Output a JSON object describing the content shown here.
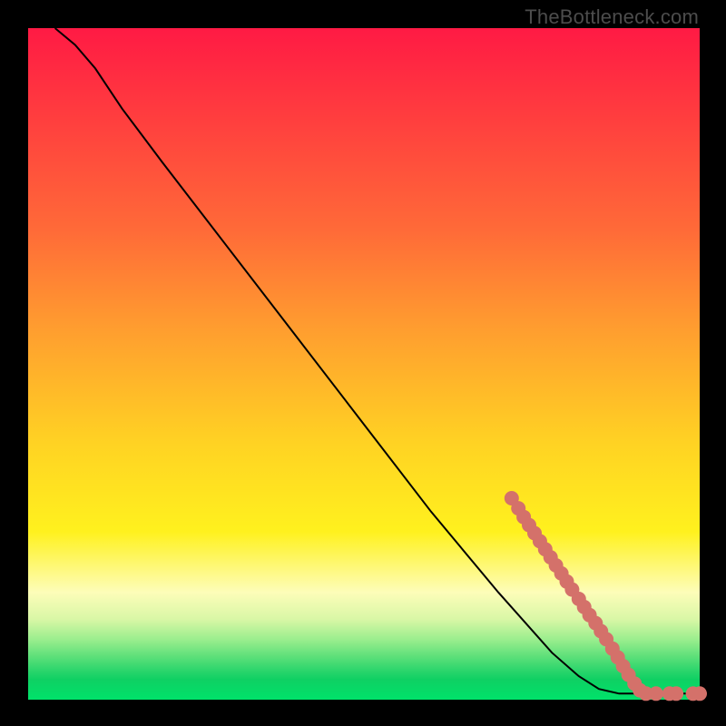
{
  "attribution": "TheBottleneck.com",
  "chart_data": {
    "type": "line",
    "title": "",
    "xlabel": "",
    "ylabel": "",
    "xlim": [
      0,
      100
    ],
    "ylim": [
      0,
      100
    ],
    "curve": [
      {
        "x": 4,
        "y": 100
      },
      {
        "x": 7,
        "y": 97.5
      },
      {
        "x": 10,
        "y": 94
      },
      {
        "x": 14,
        "y": 88
      },
      {
        "x": 20,
        "y": 80
      },
      {
        "x": 30,
        "y": 67
      },
      {
        "x": 40,
        "y": 54
      },
      {
        "x": 50,
        "y": 41
      },
      {
        "x": 60,
        "y": 28
      },
      {
        "x": 70,
        "y": 16
      },
      {
        "x": 78,
        "y": 7
      },
      {
        "x": 82,
        "y": 3.5
      },
      {
        "x": 85,
        "y": 1.6
      },
      {
        "x": 88,
        "y": 0.9
      },
      {
        "x": 92,
        "y": 0.9
      },
      {
        "x": 96,
        "y": 0.9
      },
      {
        "x": 100,
        "y": 0.9
      }
    ],
    "markers": [
      {
        "x": 72.0,
        "y": 30.0
      },
      {
        "x": 73.0,
        "y": 28.5
      },
      {
        "x": 73.8,
        "y": 27.2
      },
      {
        "x": 74.6,
        "y": 26.0
      },
      {
        "x": 75.4,
        "y": 24.8
      },
      {
        "x": 76.2,
        "y": 23.6
      },
      {
        "x": 77.0,
        "y": 22.4
      },
      {
        "x": 77.8,
        "y": 21.2
      },
      {
        "x": 78.6,
        "y": 20.0
      },
      {
        "x": 79.4,
        "y": 18.8
      },
      {
        "x": 80.2,
        "y": 17.6
      },
      {
        "x": 81.0,
        "y": 16.4
      },
      {
        "x": 82.0,
        "y": 15.0
      },
      {
        "x": 82.8,
        "y": 13.8
      },
      {
        "x": 83.6,
        "y": 12.6
      },
      {
        "x": 84.5,
        "y": 11.4
      },
      {
        "x": 85.3,
        "y": 10.2
      },
      {
        "x": 86.1,
        "y": 9.0
      },
      {
        "x": 87.0,
        "y": 7.6
      },
      {
        "x": 87.8,
        "y": 6.3
      },
      {
        "x": 88.6,
        "y": 5.0
      },
      {
        "x": 89.4,
        "y": 3.7
      },
      {
        "x": 90.3,
        "y": 2.4
      },
      {
        "x": 91.1,
        "y": 1.4
      },
      {
        "x": 92.0,
        "y": 0.9
      },
      {
        "x": 93.5,
        "y": 0.9
      },
      {
        "x": 95.5,
        "y": 0.9
      },
      {
        "x": 96.5,
        "y": 0.9
      },
      {
        "x": 99.0,
        "y": 0.9
      },
      {
        "x": 100.0,
        "y": 0.9
      }
    ],
    "marker_radius_px": 8,
    "gradient_stops": [
      {
        "pos": 0,
        "color": "#ff1a44"
      },
      {
        "pos": 50,
        "color": "#ffb22a"
      },
      {
        "pos": 75,
        "color": "#fff11e"
      },
      {
        "pos": 100,
        "color": "#00e26a"
      }
    ]
  }
}
